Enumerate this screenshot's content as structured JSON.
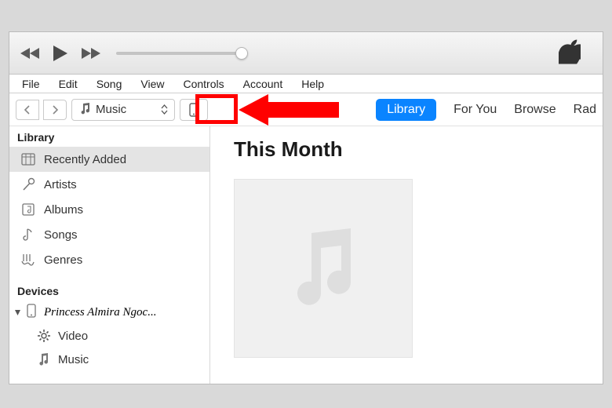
{
  "menubar": [
    "File",
    "Edit",
    "Song",
    "View",
    "Controls",
    "Account",
    "Help"
  ],
  "toolbar": {
    "media_selector_label": "Music",
    "tabs": [
      {
        "label": "Library",
        "active": true
      },
      {
        "label": "For You",
        "active": false
      },
      {
        "label": "Browse",
        "active": false
      },
      {
        "label": "Rad",
        "active": false
      }
    ]
  },
  "sidebar": {
    "library_header": "Library",
    "library_items": [
      {
        "label": "Recently Added",
        "icon": "grid-icon",
        "selected": true
      },
      {
        "label": "Artists",
        "icon": "mic-icon",
        "selected": false
      },
      {
        "label": "Albums",
        "icon": "album-icon",
        "selected": false
      },
      {
        "label": "Songs",
        "icon": "note-icon",
        "selected": false
      },
      {
        "label": "Genres",
        "icon": "guitar-icon",
        "selected": false
      }
    ],
    "devices_header": "Devices",
    "device_name": "Princess Almira Ngoc...",
    "device_children": [
      {
        "label": "Video",
        "icon": "gear-icon"
      },
      {
        "label": "Music",
        "icon": "note-icon"
      }
    ]
  },
  "content": {
    "heading": "This Month"
  },
  "annotation": {
    "highlight_target": "device-button"
  }
}
